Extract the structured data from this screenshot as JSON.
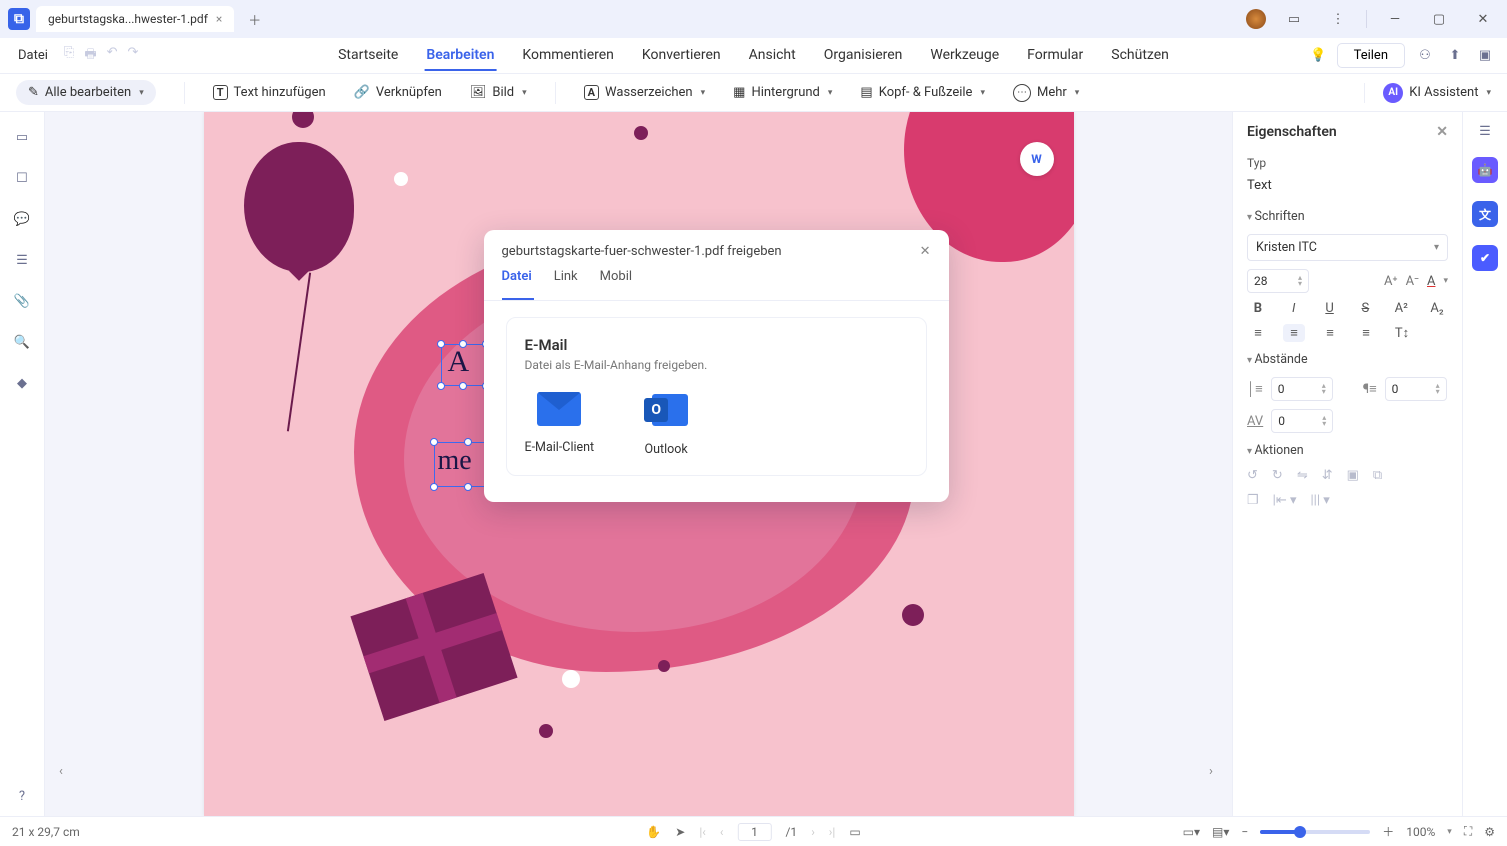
{
  "titlebar": {
    "tab_title": "geburtstagska...hwester-1.pdf"
  },
  "menu": {
    "file": "Datei",
    "tabs": [
      "Startseite",
      "Bearbeiten",
      "Kommentieren",
      "Konvertieren",
      "Ansicht",
      "Organisieren",
      "Werkzeuge",
      "Formular",
      "Schützen"
    ],
    "active_index": 1,
    "share": "Teilen"
  },
  "toolbar": {
    "edit_all": "Alle bearbeiten",
    "add_text": "Text hinzufügen",
    "link": "Verknüpfen",
    "image": "Bild",
    "watermark": "Wasserzeichen",
    "background": "Hintergrund",
    "header_footer": "Kopf- & Fußzeile",
    "more": "Mehr",
    "ai": "KI Assistent"
  },
  "modal": {
    "title": "geburtstagskarte-fuer-schwester-1.pdf freigeben",
    "tabs": [
      "Datei",
      "Link",
      "Mobil"
    ],
    "active_index": 0,
    "section_title": "E-Mail",
    "section_sub": "Datei als E-Mail-Anhang freigeben.",
    "apps": [
      {
        "label": "E-Mail-Client"
      },
      {
        "label": "Outlook"
      }
    ]
  },
  "properties": {
    "title": "Eigenschaften",
    "type_label": "Typ",
    "type_value": "Text",
    "fonts_section": "Schriften",
    "font_name": "Kristen ITC",
    "font_size": "28",
    "spacing_section": "Abstände",
    "line_spacing": "0",
    "para_spacing": "0",
    "char_spacing": "0",
    "actions_section": "Aktionen"
  },
  "status": {
    "dims": "21 x 29,7 cm",
    "page_current": "1",
    "page_total": "/1",
    "zoom": "100%"
  }
}
